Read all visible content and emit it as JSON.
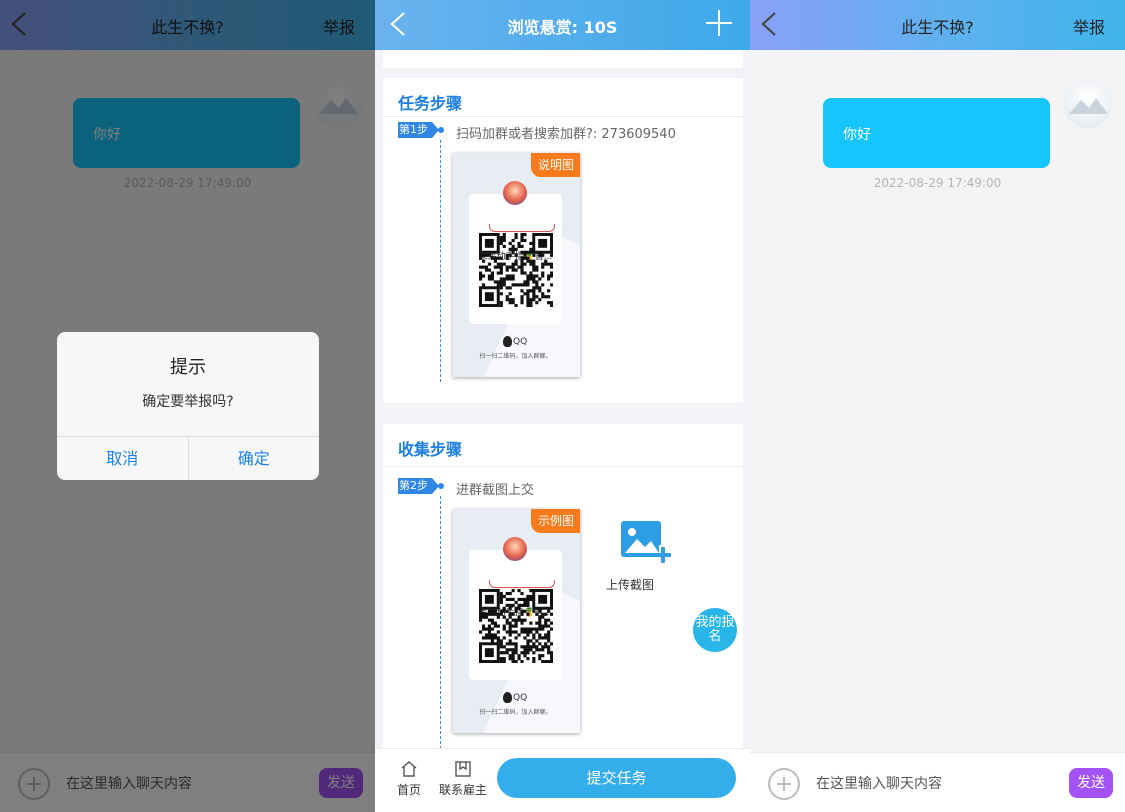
{
  "screens": {
    "left": {
      "header": {
        "title": "此生不换?",
        "report": "举报"
      },
      "message": {
        "text": "你好",
        "time": "2022-08-29 17:49:00"
      },
      "dialog": {
        "title": "提示",
        "message": "确定要举报吗?",
        "cancel": "取消",
        "confirm": "确定"
      },
      "input": {
        "placeholder": "在这里输入聊天内容",
        "send": "发送"
      }
    },
    "middle": {
      "header": {
        "title": "浏览悬赏: 10S"
      },
      "task_section": {
        "title": "任务步骤",
        "step_tag": "第1步",
        "step_text": "扫码加群或者搜索加群?: 273609540",
        "badge": "说明图",
        "qr_name": "呆呆动手指🍍官...",
        "qr_caption": "扫一扫二维码，加入群聊。",
        "qq": "QQ"
      },
      "collect_section": {
        "title": "收集步骤",
        "step_tag": "第2步",
        "step_text": "进群截图上交",
        "badge": "示例图",
        "qr_name": "呆呆动手指🍍官...",
        "qr_caption": "扫一扫二维码，加入群聊。",
        "qq": "QQ",
        "upload_label": "上传截图",
        "fab": "我的报名"
      },
      "bottom_nav": {
        "home": "首页",
        "contact": "联系雇主",
        "submit": "提交任务"
      }
    },
    "right": {
      "header": {
        "title": "此生不换?",
        "report": "举报"
      },
      "message": {
        "text": "你好",
        "time": "2022-08-29 17:49:00"
      },
      "input": {
        "placeholder": "在这里输入聊天内容",
        "send": "发送"
      }
    }
  },
  "colors": {
    "bubble": "#15c5fb",
    "send_button": "#a451f5",
    "accent_blue": "#1e7fe0",
    "badge_orange": "#f97a1a",
    "submit_button": "#34aeea",
    "dialog_button_text": "#1e82e8"
  },
  "icons": [
    "back-chevron-icon",
    "plus-icon",
    "add-circle-icon",
    "image-upload-icon",
    "home-icon",
    "bookmark-icon",
    "qq-penguin-icon"
  ]
}
